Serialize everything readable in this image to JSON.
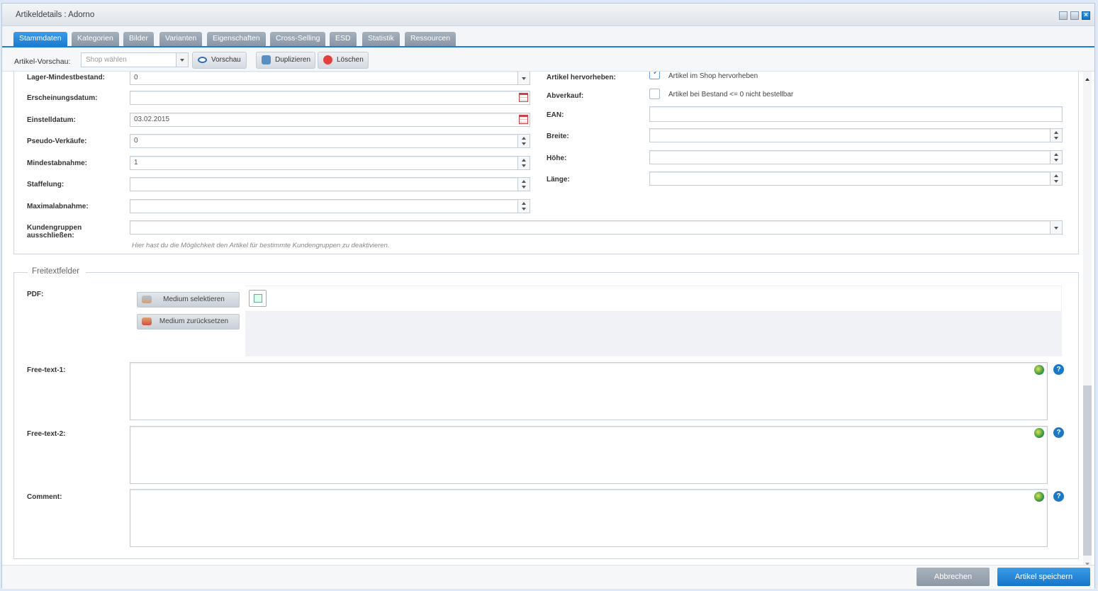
{
  "window": {
    "title": "Artikeldetails : Adorno"
  },
  "tabs": [
    {
      "label": "Stammdaten"
    },
    {
      "label": "Kategorien"
    },
    {
      "label": "Bilder"
    },
    {
      "label": "Varianten"
    },
    {
      "label": "Eigenschaften"
    },
    {
      "label": "Cross-Selling"
    },
    {
      "label": "ESD"
    },
    {
      "label": "Statistik"
    },
    {
      "label": "Ressourcen"
    }
  ],
  "toolbar": {
    "preview_label": "Artikel-Vorschau:",
    "shop_placeholder": "Shop wählen",
    "preview_button": "Vorschau",
    "duplicate_button": "Duplizieren",
    "delete_button": "Löschen"
  },
  "form_left": {
    "lager_label": "Lager-Mindestbestand:",
    "lager_value": "0",
    "erscheinung_label": "Erscheinungsdatum:",
    "erscheinung_value": "",
    "einstell_label": "Einstelldatum:",
    "einstell_value": "03.02.2015",
    "pseudo_label": "Pseudo-Verkäufe:",
    "pseudo_value": "0",
    "mindest_label": "Mindestabnahme:",
    "mindest_value": "1",
    "staffel_label": "Staffelung:",
    "staffel_value": "",
    "maximal_label": "Maximalabnahme:",
    "maximal_value": ""
  },
  "form_right": {
    "hervorheben_label": "Artikel hervorheben:",
    "hervorheben_text": "Artikel im Shop hervorheben",
    "hervorheben_checked": true,
    "abverkauf_label": "Abverkauf:",
    "abverkauf_text": "Artikel bei Bestand <= 0 nicht bestellbar",
    "abverkauf_checked": false,
    "ean_label": "EAN:",
    "breite_label": "Breite:",
    "hoehe_label": "Höhe:",
    "laenge_label": "Länge:"
  },
  "kundengruppen": {
    "label_line1": "Kundengruppen",
    "label_line2": "ausschließen:",
    "hint": "Hier hast du die Möglichkeit den Artikel für bestimmte Kundengruppen zu deaktivieren."
  },
  "freitext": {
    "legend": "Freitextfelder",
    "pdf_label": "PDF:",
    "select_button": "Medium selektieren",
    "reset_button": "Medium zurücksetzen",
    "free1_label": "Free-text-1:",
    "free2_label": "Free-text-2:",
    "comment_label": "Comment:"
  },
  "footer": {
    "cancel": "Abbrechen",
    "save": "Artikel speichern"
  },
  "colors": {
    "accent": "#1b7dd0",
    "tab_inactive": "#8a96a6",
    "cancel_btn": "#9aa5b1"
  },
  "icons": [
    "eye-icon",
    "duplicate-icon",
    "delete-icon",
    "calendar-icon",
    "globe-icon",
    "help-icon",
    "media-icon"
  ]
}
